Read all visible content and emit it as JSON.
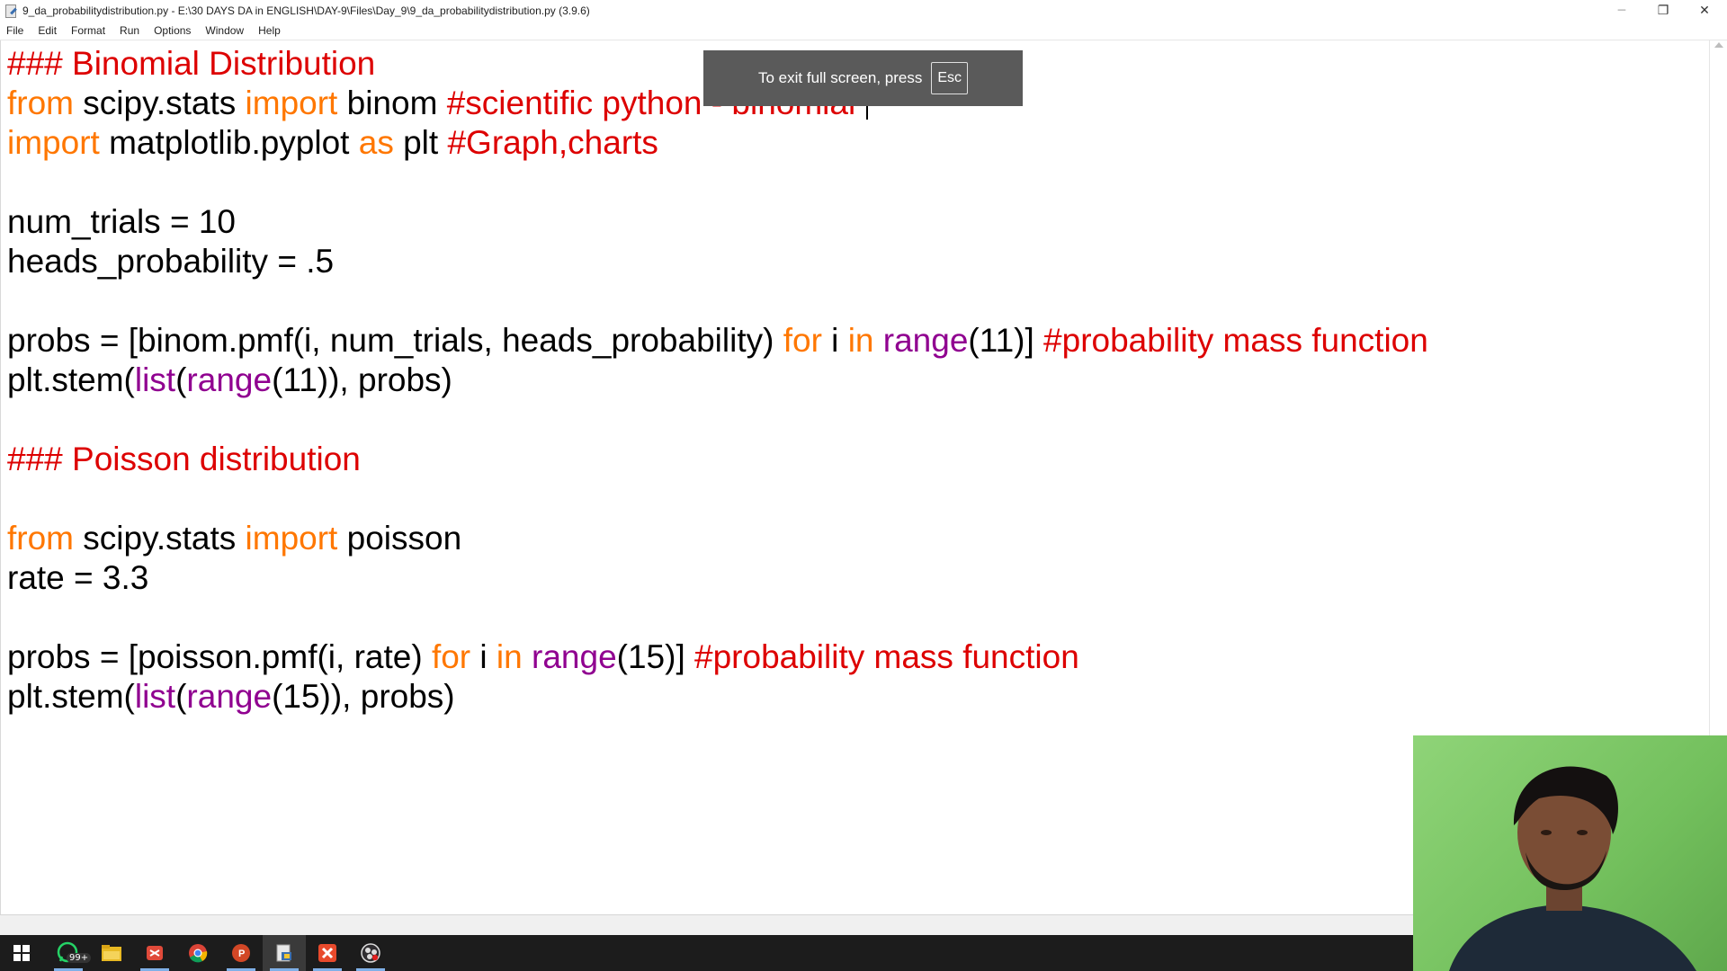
{
  "window": {
    "title": "9_da_probabilitydistribution.py - E:\\30 DAYS DA in ENGLISH\\DAY-9\\Files\\Day_9\\9_da_probabilitydistribution.py (3.9.6)",
    "controls": {
      "minimize": "─",
      "maximize": "❐",
      "close": "✕"
    }
  },
  "menu": [
    "File",
    "Edit",
    "Format",
    "Run",
    "Options",
    "Window",
    "Help"
  ],
  "fullscreen_toast": {
    "text": "To exit full screen, press",
    "key": "Esc"
  },
  "colors": {
    "keyword": "#ff7700",
    "comment": "#dd0000",
    "builtin": "#900090",
    "text": "#000000"
  },
  "code": {
    "lines": [
      [
        {
          "t": "### Binomial Distribution",
          "c": "cm"
        }
      ],
      [
        {
          "t": "from",
          "c": "kw"
        },
        {
          "t": " scipy.stats "
        },
        {
          "t": "import",
          "c": "kw"
        },
        {
          "t": " binom "
        },
        {
          "t": "#scientific python - binomial ",
          "c": "cm"
        },
        {
          "caret": true
        }
      ],
      [
        {
          "t": "import",
          "c": "kw"
        },
        {
          "t": " matplotlib.pyplot "
        },
        {
          "t": "as",
          "c": "kw"
        },
        {
          "t": " plt "
        },
        {
          "t": "#Graph,charts",
          "c": "cm"
        }
      ],
      [],
      [
        {
          "t": "num_trials = 10"
        }
      ],
      [
        {
          "t": "heads_probability = .5"
        }
      ],
      [],
      [
        {
          "t": "probs = [binom.pmf(i, num_trials, heads_probability) "
        },
        {
          "t": "for",
          "c": "kw"
        },
        {
          "t": " i "
        },
        {
          "t": "in",
          "c": "kw"
        },
        {
          "t": " "
        },
        {
          "t": "range",
          "c": "bi"
        },
        {
          "t": "(11)] "
        },
        {
          "t": "#probability mass function",
          "c": "cm"
        }
      ],
      [
        {
          "t": "plt.stem("
        },
        {
          "t": "list",
          "c": "bi"
        },
        {
          "t": "("
        },
        {
          "t": "range",
          "c": "bi"
        },
        {
          "t": "(11)), probs)"
        }
      ],
      [],
      [
        {
          "t": "### Poisson distribution",
          "c": "cm"
        }
      ],
      [],
      [
        {
          "t": "from",
          "c": "kw"
        },
        {
          "t": " scipy.stats "
        },
        {
          "t": "import",
          "c": "kw"
        },
        {
          "t": " poisson"
        }
      ],
      [
        {
          "t": "rate = 3.3"
        }
      ],
      [],
      [
        {
          "t": "probs = [poisson.pmf(i, rate) "
        },
        {
          "t": "for",
          "c": "kw"
        },
        {
          "t": " i "
        },
        {
          "t": "in",
          "c": "kw"
        },
        {
          "t": " "
        },
        {
          "t": "range",
          "c": "bi"
        },
        {
          "t": "(15)] "
        },
        {
          "t": "#probability mass function",
          "c": "cm"
        }
      ],
      [
        {
          "t": "plt.stem("
        },
        {
          "t": "list",
          "c": "bi"
        },
        {
          "t": "("
        },
        {
          "t": "range",
          "c": "bi"
        },
        {
          "t": "(15)), probs)"
        }
      ]
    ]
  },
  "taskbar": {
    "icons": [
      "windows-start-icon",
      "whatsapp-icon",
      "file-explorer-icon",
      "snipping-tool-icon",
      "chrome-icon",
      "powerpoint-icon",
      "python-idle-icon",
      "xmind-icon",
      "obs-icon"
    ],
    "whatsapp_badge": "99+"
  }
}
